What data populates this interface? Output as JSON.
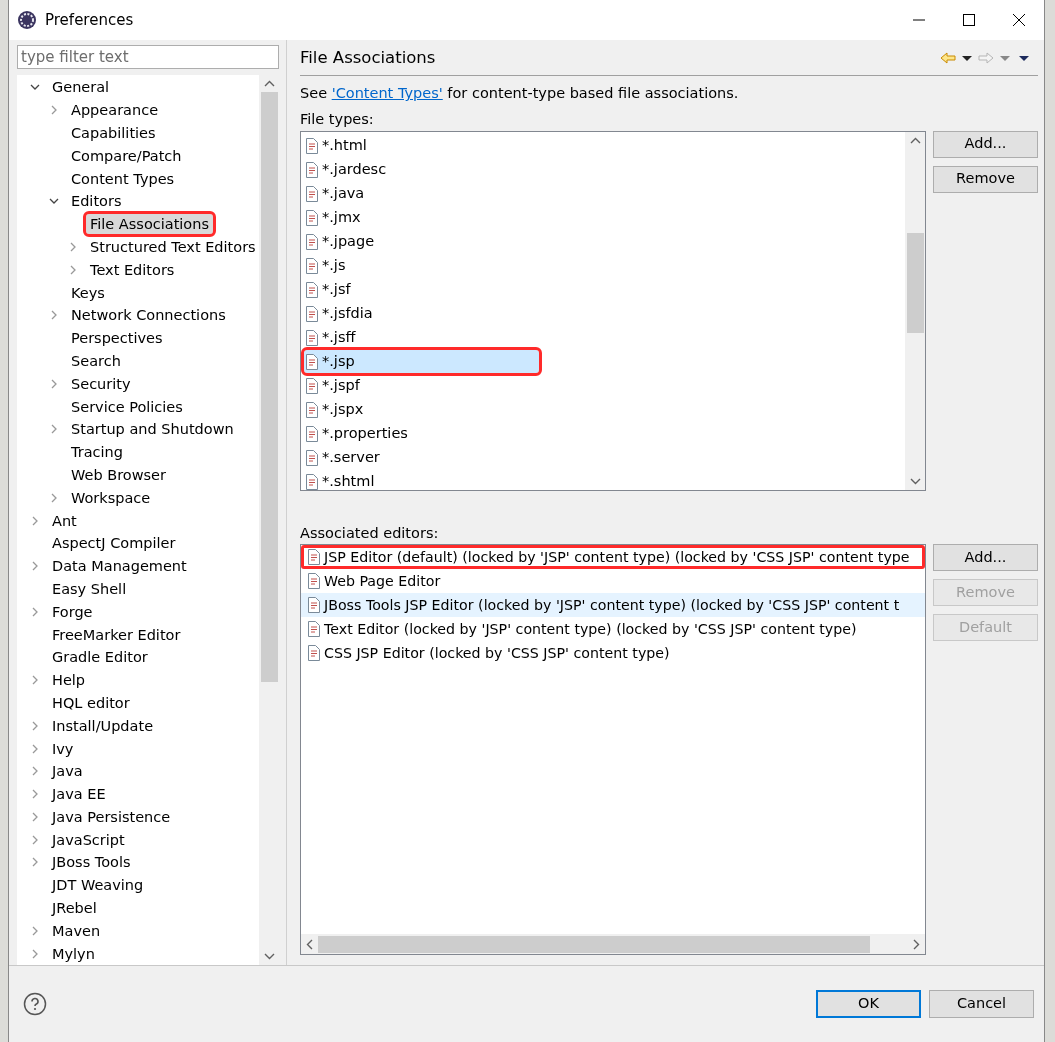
{
  "window": {
    "title": "Preferences"
  },
  "filter": {
    "placeholder": "type filter text"
  },
  "tree": [
    {
      "label": "General",
      "expanded": true,
      "selected": false,
      "annotated": false,
      "children": [
        {
          "label": "Appearance",
          "expanded": false,
          "selected": false,
          "annotated": false
        },
        {
          "label": "Capabilities",
          "selected": false,
          "annotated": false
        },
        {
          "label": "Compare/Patch",
          "selected": false,
          "annotated": false
        },
        {
          "label": "Content Types",
          "selected": false,
          "annotated": false
        },
        {
          "label": "Editors",
          "expanded": true,
          "selected": false,
          "annotated": false,
          "children": [
            {
              "label": "File Associations",
              "selected": true,
              "annotated": true
            },
            {
              "label": "Structured Text Editors",
              "expanded": false,
              "selected": false,
              "annotated": false
            },
            {
              "label": "Text Editors",
              "expanded": false,
              "selected": false,
              "annotated": false
            }
          ]
        },
        {
          "label": "Keys",
          "selected": false,
          "annotated": false
        },
        {
          "label": "Network Connections",
          "expanded": false,
          "selected": false,
          "annotated": false
        },
        {
          "label": "Perspectives",
          "selected": false,
          "annotated": false
        },
        {
          "label": "Search",
          "selected": false,
          "annotated": false
        },
        {
          "label": "Security",
          "expanded": false,
          "selected": false,
          "annotated": false
        },
        {
          "label": "Service Policies",
          "selected": false,
          "annotated": false
        },
        {
          "label": "Startup and Shutdown",
          "expanded": false,
          "selected": false,
          "annotated": false
        },
        {
          "label": "Tracing",
          "selected": false,
          "annotated": false
        },
        {
          "label": "Web Browser",
          "selected": false,
          "annotated": false
        },
        {
          "label": "Workspace",
          "expanded": false,
          "selected": false,
          "annotated": false
        }
      ]
    },
    {
      "label": "Ant",
      "expanded": false,
      "selected": false,
      "annotated": false
    },
    {
      "label": "AspectJ Compiler",
      "selected": false,
      "annotated": false
    },
    {
      "label": "Data Management",
      "expanded": false,
      "selected": false,
      "annotated": false
    },
    {
      "label": "Easy Shell",
      "selected": false,
      "annotated": false
    },
    {
      "label": "Forge",
      "expanded": false,
      "selected": false,
      "annotated": false
    },
    {
      "label": "FreeMarker Editor",
      "selected": false,
      "annotated": false
    },
    {
      "label": "Gradle Editor",
      "selected": false,
      "annotated": false
    },
    {
      "label": "Help",
      "expanded": false,
      "selected": false,
      "annotated": false
    },
    {
      "label": "HQL editor",
      "selected": false,
      "annotated": false
    },
    {
      "label": "Install/Update",
      "expanded": false,
      "selected": false,
      "annotated": false
    },
    {
      "label": "Ivy",
      "expanded": false,
      "selected": false,
      "annotated": false
    },
    {
      "label": "Java",
      "expanded": false,
      "selected": false,
      "annotated": false
    },
    {
      "label": "Java EE",
      "expanded": false,
      "selected": false,
      "annotated": false
    },
    {
      "label": "Java Persistence",
      "expanded": false,
      "selected": false,
      "annotated": false
    },
    {
      "label": "JavaScript",
      "expanded": false,
      "selected": false,
      "annotated": false
    },
    {
      "label": "JBoss Tools",
      "expanded": false,
      "selected": false,
      "annotated": false
    },
    {
      "label": "JDT Weaving",
      "selected": false,
      "annotated": false
    },
    {
      "label": "JRebel",
      "selected": false,
      "annotated": false
    },
    {
      "label": "Maven",
      "expanded": false,
      "selected": false,
      "annotated": false
    },
    {
      "label": "Mylyn",
      "expanded": false,
      "selected": false,
      "annotated": false
    }
  ],
  "page": {
    "title": "File Associations",
    "intro": {
      "before": "See ",
      "link": "'Content Types'",
      "after": " for content-type based file associations."
    },
    "file_types_label": "File types:",
    "file_types": [
      {
        "label": "*.html",
        "selected": false,
        "annotated": false
      },
      {
        "label": "*.jardesc",
        "selected": false,
        "annotated": false
      },
      {
        "label": "*.java",
        "selected": false,
        "annotated": false
      },
      {
        "label": "*.jmx",
        "selected": false,
        "annotated": false
      },
      {
        "label": "*.jpage",
        "selected": false,
        "annotated": false
      },
      {
        "label": "*.js",
        "selected": false,
        "annotated": false
      },
      {
        "label": "*.jsf",
        "selected": false,
        "annotated": false
      },
      {
        "label": "*.jsfdia",
        "selected": false,
        "annotated": false
      },
      {
        "label": "*.jsff",
        "selected": false,
        "annotated": false
      },
      {
        "label": "*.jsp",
        "selected": true,
        "annotated": true
      },
      {
        "label": "*.jspf",
        "selected": false,
        "annotated": false
      },
      {
        "label": "*.jspx",
        "selected": false,
        "annotated": false
      },
      {
        "label": "*.properties",
        "selected": false,
        "annotated": false
      },
      {
        "label": "*.server",
        "selected": false,
        "annotated": false
      },
      {
        "label": "*.shtml",
        "selected": false,
        "annotated": false
      }
    ],
    "file_type_buttons": [
      {
        "label": "Add...",
        "disabled": false
      },
      {
        "label": "Remove",
        "disabled": false
      }
    ],
    "editors_label": "Associated editors:",
    "editors": [
      {
        "label": "JSP Editor (default) (locked by 'JSP' content type) (locked by 'CSS JSP' content type",
        "hovered": false,
        "annotated": true
      },
      {
        "label": "Web Page Editor",
        "hovered": false,
        "annotated": false
      },
      {
        "label": "JBoss Tools JSP Editor (locked by 'JSP' content type) (locked by 'CSS JSP' content t",
        "hovered": true,
        "annotated": false
      },
      {
        "label": "Text Editor (locked by 'JSP' content type) (locked by 'CSS JSP' content type)",
        "hovered": false,
        "annotated": false
      },
      {
        "label": "CSS JSP Editor (locked by 'CSS JSP' content type)",
        "hovered": false,
        "annotated": false
      }
    ],
    "editor_buttons": [
      {
        "label": "Add...",
        "disabled": false
      },
      {
        "label": "Remove",
        "disabled": true
      },
      {
        "label": "Default",
        "disabled": true
      }
    ]
  },
  "footer_buttons": [
    {
      "label": "OK",
      "default": true
    },
    {
      "label": "Cancel",
      "default": false
    }
  ]
}
